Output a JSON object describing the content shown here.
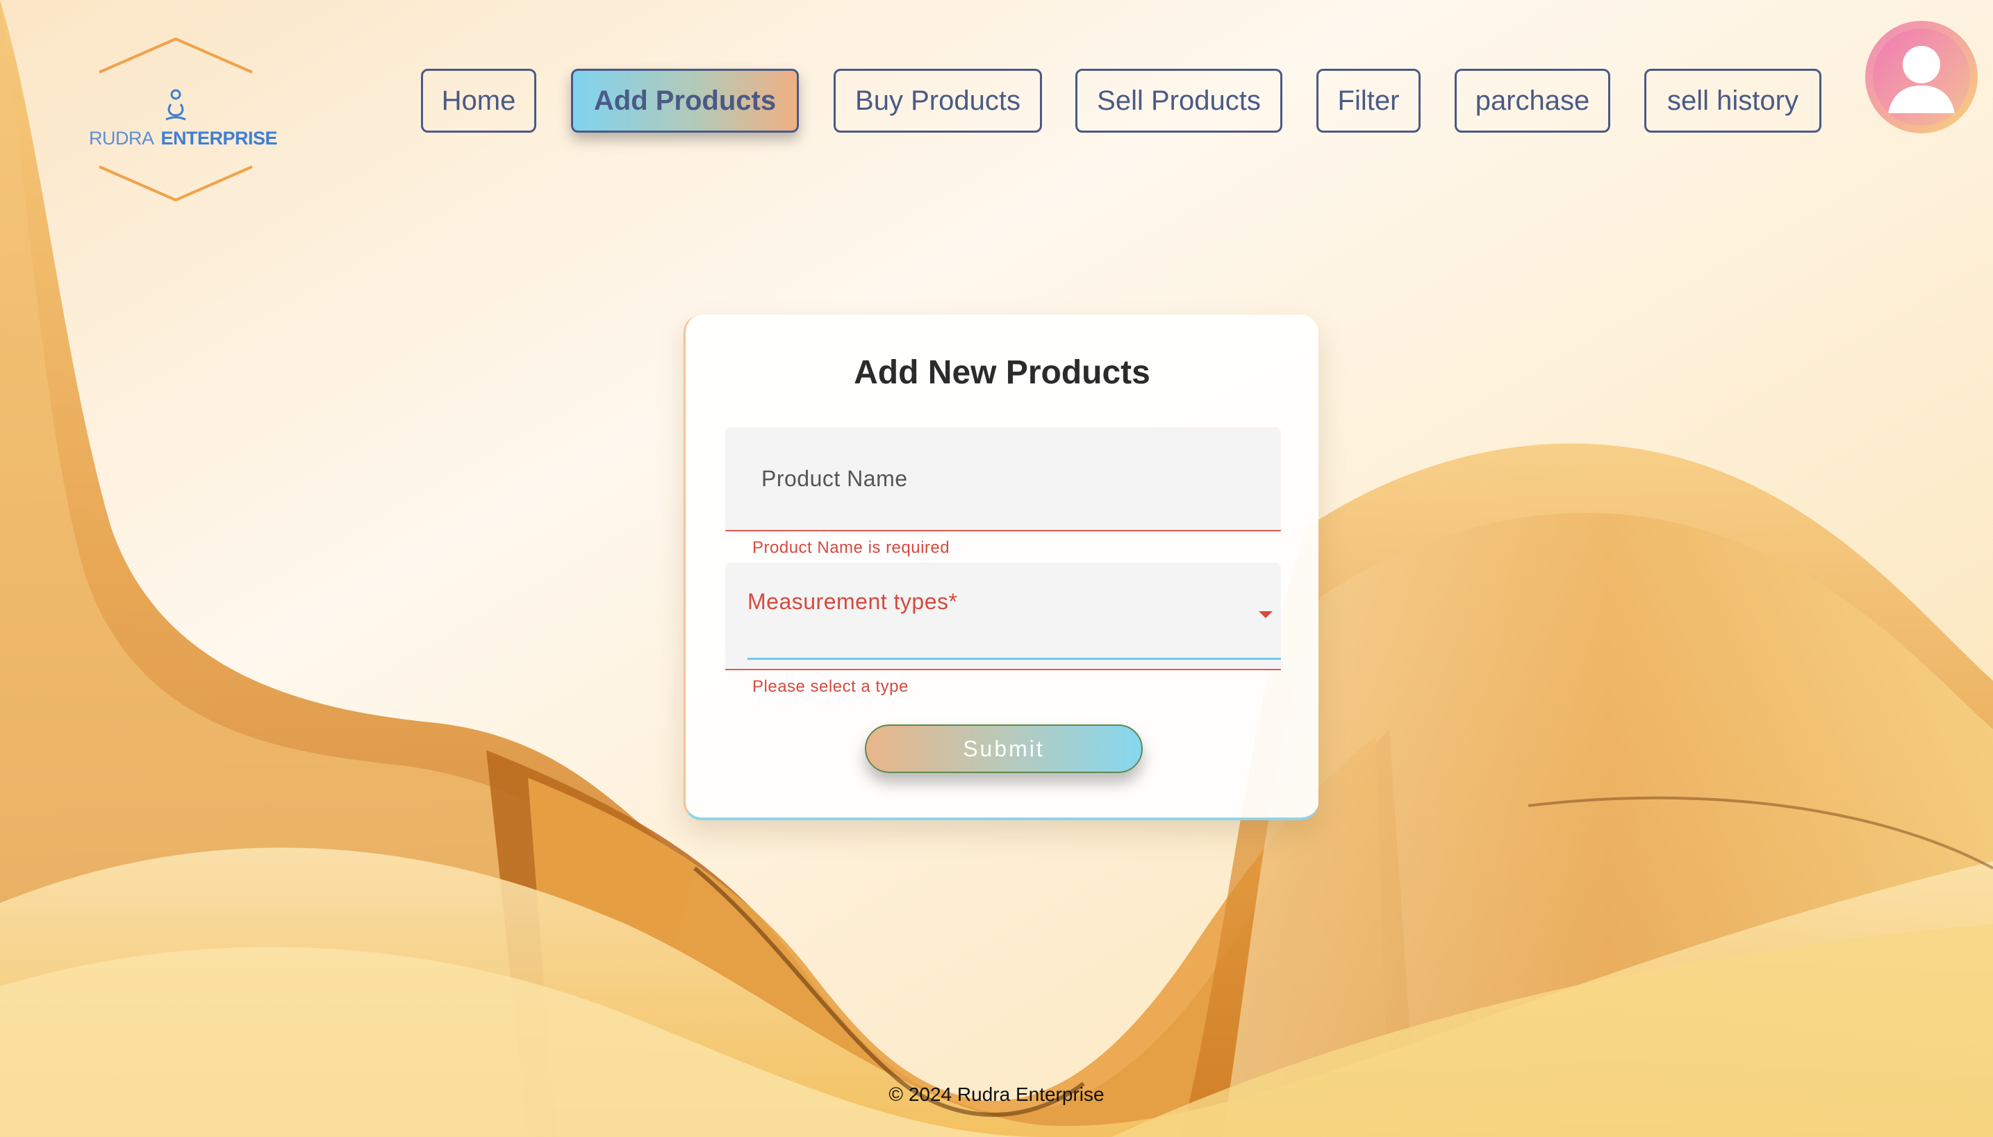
{
  "brand": {
    "word1": "RUDRA",
    "word2": "ENTERPRISE",
    "logo_icon": "meditation-person-icon",
    "accent_orange": "#f0a24a",
    "accent_blue": "#3d7fd6"
  },
  "nav": {
    "items": [
      {
        "label": "Home",
        "active": false
      },
      {
        "label": "Add Products",
        "active": true
      },
      {
        "label": "Buy Products",
        "active": false
      },
      {
        "label": "Sell Products",
        "active": false
      },
      {
        "label": "Filter",
        "active": false
      },
      {
        "label": "parchase",
        "active": false
      },
      {
        "label": "sell history",
        "active": false
      }
    ],
    "text_color": "#4a5a86"
  },
  "user": {
    "avatar_icon": "user-avatar-icon"
  },
  "form": {
    "title": "Add New Products",
    "product_name": {
      "label": "Product Name",
      "value": "",
      "error": "Product Name is required"
    },
    "measurement": {
      "label": "Measurement types*",
      "selected": "",
      "error": "Please select a type"
    },
    "submit_label": "Submit",
    "error_color": "#d64a3f"
  },
  "footer": {
    "text": "© 2024 Rudra Enterprise"
  }
}
